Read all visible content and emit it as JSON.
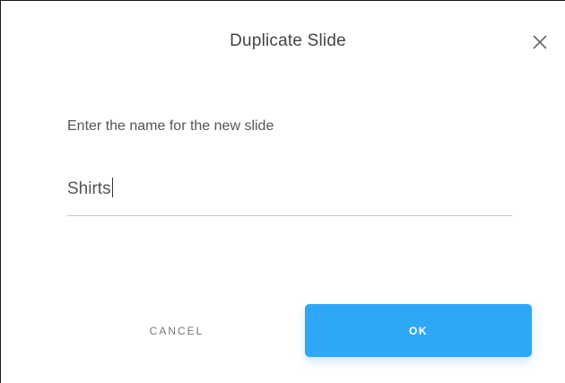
{
  "dialog": {
    "title": "Duplicate Slide",
    "prompt": "Enter the name for the new slide",
    "input_value": "Shirts",
    "cancel_label": "CANCEL",
    "ok_label": "OK",
    "close_icon": "close-icon",
    "accent_color": "#2ea7f7"
  }
}
